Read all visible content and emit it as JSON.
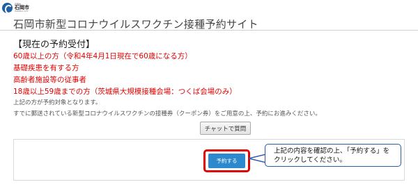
{
  "header": {
    "logo_small": "石岡市",
    "logo_name": "石岡市",
    "logo_roman": "ISHIOKA CITY",
    "title": "石岡市新型コロナウイルスワクチン接種予約サイト"
  },
  "section": {
    "heading": "【現在の予約受付】",
    "eligible": [
      "60歳以上の方（令和4年4月1日現在で60歳になる方）",
      "基礎疾患を有する方",
      "高齢者施設等の従事者",
      "18歳以上59歳までの方（茨城県大規模接種会場：つくば会場のみ）"
    ],
    "note1": "上記の方が予約対象となります。",
    "note2": "すでに郵送されている新型コロナウイルスワクチンの接種券（クーポン券）をご用意の上、予約にお進みください。"
  },
  "buttons": {
    "chat_label": "チャットで質問",
    "reserve_label": "予約する"
  },
  "callout": {
    "line1": "上記の内容を確認の上、「予約する」を",
    "line2": "クリックしてください。"
  },
  "colors": {
    "eligible_text": "#e00000",
    "reserve_button": "#2d89cd",
    "highlight_border": "#e00000",
    "callout_border": "#2a5aa8"
  }
}
